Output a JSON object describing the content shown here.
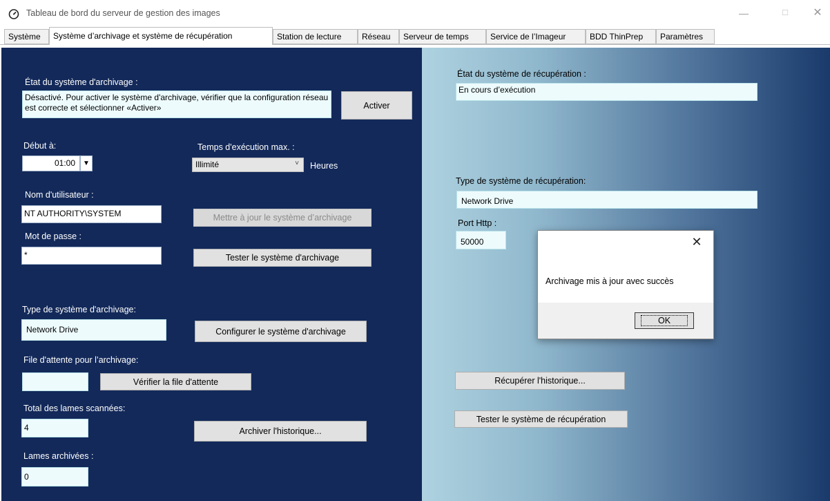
{
  "window": {
    "title": "Tableau de bord du serveur de gestion des images",
    "min_glyph": "—",
    "max_glyph": "☐",
    "close_glyph": "✕"
  },
  "tabs": [
    {
      "label": "Système",
      "active": false
    },
    {
      "label": "Système d’archivage et système de récupération",
      "active": true
    },
    {
      "label": "Station de lecture",
      "active": false
    },
    {
      "label": "Réseau",
      "active": false
    },
    {
      "label": "Serveur de temps",
      "active": false
    },
    {
      "label": "Service de l’Imageur",
      "active": false
    },
    {
      "label": "BDD ThinPrep",
      "active": false
    },
    {
      "label": "Paramètres",
      "active": false
    }
  ],
  "archive": {
    "status_label": "État du système d'archivage :",
    "status_text": "Désactivé. Pour activer le système d'archivage, vérifier que la configuration réseau est correcte et sélectionner «Activer»",
    "activate_button": "Activer",
    "start_label": "Début à:",
    "start_time": "01:00",
    "runtime_label": "Temps d'exécution max. :",
    "runtime_value": "Illimité",
    "runtime_unit": "Heures",
    "username_label": "Nom d'utilisateur :",
    "username_value": "NT AUTHORITY\\SYSTEM",
    "update_button": "Mettre à jour le système d’archivage",
    "password_label": "Mot de passe :",
    "password_value": "*",
    "test_button": "Tester le système d'archivage",
    "type_label": "Type de système d'archivage:",
    "type_value": "Network Drive",
    "configure_button": "Configurer le système d'archivage",
    "queue_label": "File d'attente  pour l’archivage:",
    "queue_value": "",
    "queue_button": "Vérifier la file d'attente",
    "total_label": "Total des lames scannées:",
    "total_value": "4",
    "history_button": "Archiver l'historique...",
    "archived_label": "Lames archivées :",
    "archived_value": "0"
  },
  "retrieval": {
    "status_label": "État du système de récupération :",
    "status_value": "En cours d’exécution",
    "type_label": "Type de système de récupération:",
    "type_value": "Network Drive",
    "port_label": "Port Http :",
    "port_value": "50000",
    "history_button": "Récupérer l'historique...",
    "test_button": "Tester le système de récupération"
  },
  "dialog": {
    "message": "Archivage mis à jour avec succès",
    "ok_button": "OK",
    "close_glyph": "✕"
  },
  "colors": {
    "left_panel": "#13295a",
    "right_gradient_start": "#aed2e0",
    "right_gradient_end": "#193a6b"
  }
}
